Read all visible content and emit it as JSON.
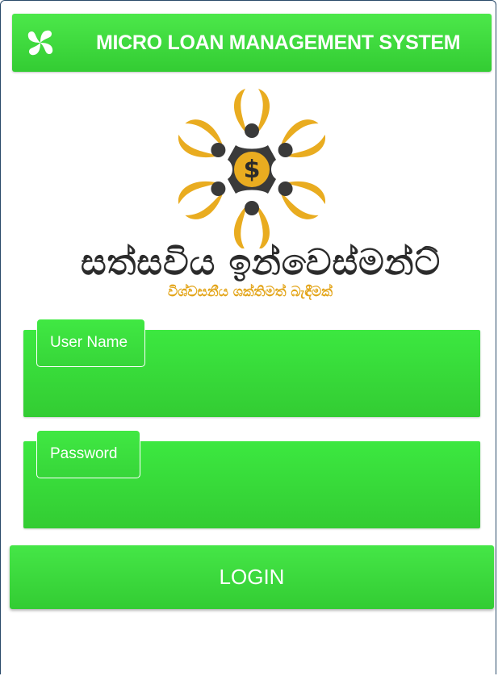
{
  "app": {
    "title": "MICRO LOAN MANAGEMENT SYSTEM",
    "header_icon": "pinwheel-icon"
  },
  "brand": {
    "name": "සත්සවිය ඉන්වෙස්මන්ට්",
    "tagline": "විශ්වසනීය ශක්තිමත් බැඳීමක්",
    "logo_icon": "sun-people-dollar-logo",
    "emblem_symbol": "$",
    "colors": {
      "gold": "#e9ac20",
      "dark": "#3a3a3a"
    }
  },
  "form": {
    "username_label": "User Name",
    "username_value": "",
    "password_label": "Password",
    "password_value": "",
    "login_label": "LOGIN"
  },
  "theme": {
    "primary": "#3cdc3e",
    "text_on_primary": "#ffffff"
  }
}
